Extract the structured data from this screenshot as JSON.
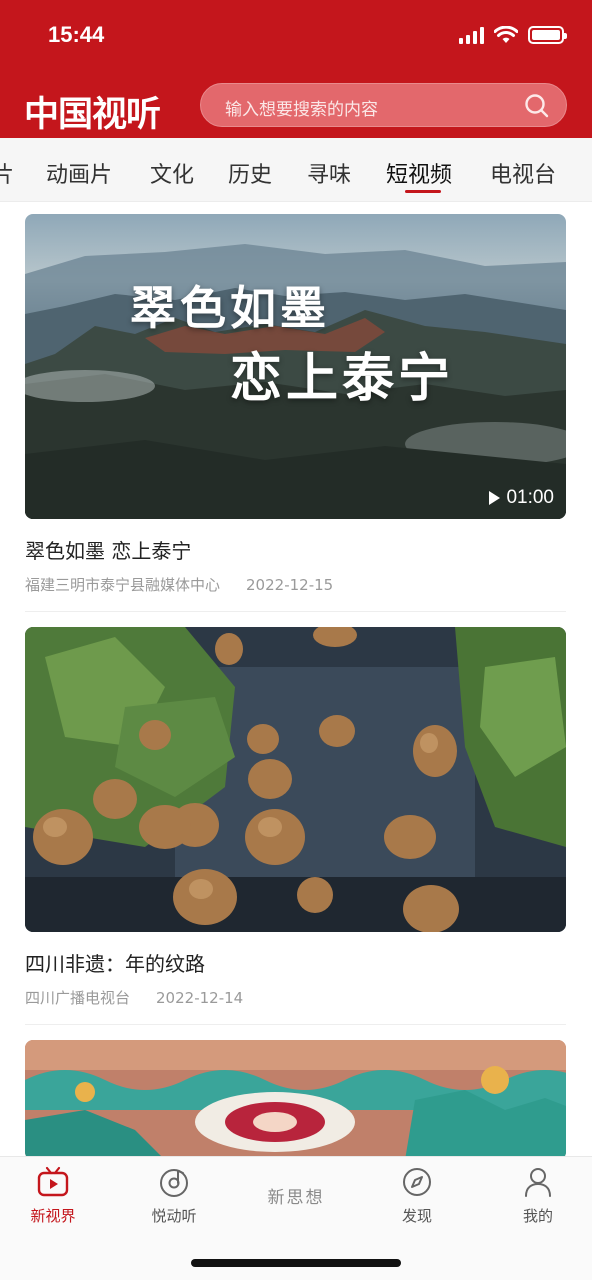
{
  "status": {
    "time": "15:44"
  },
  "header": {
    "logo": "中国视听",
    "search_placeholder": "输入想要搜索的内容"
  },
  "tabs": [
    {
      "label": "片"
    },
    {
      "label": "动画片"
    },
    {
      "label": "文化"
    },
    {
      "label": "历史"
    },
    {
      "label": "寻味"
    },
    {
      "label": "短视频",
      "active": true
    },
    {
      "label": "电视台"
    }
  ],
  "videos": [
    {
      "title": "翠色如墨 恋上泰宁",
      "overlay_line1": "翠色如墨",
      "overlay_line2": "恋上泰宁",
      "duration": "01:00",
      "source": "福建三明市泰宁县融媒体中心",
      "date": "2022-12-15"
    },
    {
      "title": "四川非遗：年的纹路",
      "source": "四川广播电视台",
      "date": "2022-12-14"
    },
    {
      "title": ""
    }
  ],
  "bottom_nav": {
    "items": [
      {
        "label": "新视界",
        "icon": "tv-icon",
        "active": true
      },
      {
        "label": "悦动听",
        "icon": "music-disc-icon"
      },
      {
        "label": "新思想",
        "icon": "none"
      },
      {
        "label": "发现",
        "icon": "compass-icon"
      },
      {
        "label": "我的",
        "icon": "person-icon"
      }
    ]
  },
  "colors": {
    "brand": "#c4161c",
    "accent_text": "#c4161c"
  }
}
